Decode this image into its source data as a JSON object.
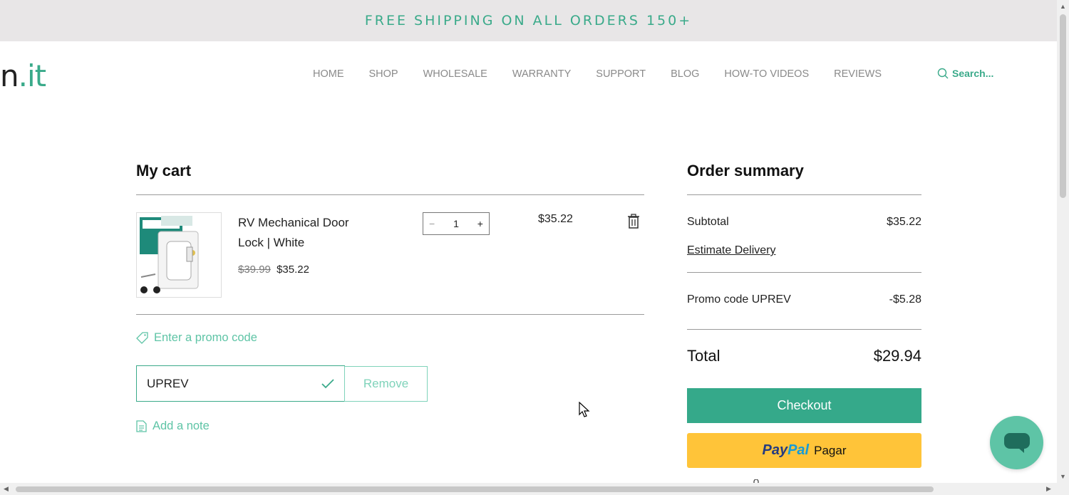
{
  "banner": {
    "text": "FREE SHIPPING ON ALL ORDERS 150+"
  },
  "logo": {
    "prefix": "n",
    "dot": ".",
    "suffix": "it"
  },
  "nav": {
    "items": [
      "HOME",
      "SHOP",
      "WHOLESALE",
      "WARRANTY",
      "SUPPORT",
      "BLOG",
      "HOW-TO VIDEOS",
      "REVIEWS"
    ],
    "search_placeholder": "Search..."
  },
  "cart": {
    "title": "My cart",
    "item": {
      "name": "RV Mechanical Door Lock | White",
      "original_price": "$39.99",
      "price": "$35.22",
      "quantity": "1",
      "line_total": "$35.22",
      "image_icon": "door-lock-product-image"
    },
    "promo_link": "Enter a promo code",
    "promo_value": "UPREV",
    "remove_label": "Remove",
    "note_link": "Add a note"
  },
  "summary": {
    "title": "Order summary",
    "subtotal_label": "Subtotal",
    "subtotal_value": "$35.22",
    "estimate_label": "Estimate Delivery",
    "promo_label": "Promo code UPREV",
    "promo_value": "-$5.28",
    "total_label": "Total",
    "total_value": "$29.94",
    "checkout_label": "Checkout",
    "paypal_brand_1": "Pay",
    "paypal_brand_2": "Pal",
    "paypal_label": "Pagar"
  },
  "colors": {
    "accent": "#3aaa8a",
    "checkout": "#35a98a",
    "paypal": "#ffc439",
    "banner_bg": "#e8e6e7"
  }
}
